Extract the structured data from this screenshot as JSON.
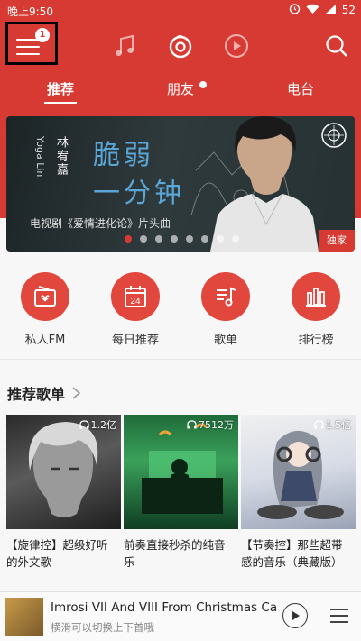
{
  "status": {
    "time": "晚上9:50",
    "battery": "52"
  },
  "nav": {
    "badge": "1"
  },
  "tabs": [
    {
      "label": "推荐"
    },
    {
      "label": "朋友"
    },
    {
      "label": "电台"
    }
  ],
  "banner": {
    "vertical_text": "Yoga Lin",
    "vertical_name": "林宥嘉",
    "title_line1": "脆弱",
    "title_line2": "一分钟",
    "subtitle": "电视剧《爱情进化论》片头曲",
    "badge": "独家",
    "page_count": 8,
    "active_page": 1
  },
  "quick_links": [
    {
      "label": "私人FM",
      "icon": "radio-icon"
    },
    {
      "label": "每日推荐",
      "icon": "calendar-icon",
      "day": "24"
    },
    {
      "label": "歌单",
      "icon": "playlist-icon"
    },
    {
      "label": "排行榜",
      "icon": "chart-icon"
    }
  ],
  "section": {
    "title": "推荐歌单"
  },
  "playlists": [
    {
      "count": "1.2亿",
      "title": "【旋律控】超级好听的外文歌"
    },
    {
      "count": "7512万",
      "title": "前奏直接秒杀的纯音乐"
    },
    {
      "count": "1.5亿",
      "title": "【节奏控】那些超带感的音乐（典藏版）"
    }
  ],
  "player": {
    "title": "Imrosi VII And VIII From Christmas Carol",
    "subtitle": "横滑可以切换上下首哦"
  },
  "colors": {
    "brand": "#d63a32"
  }
}
